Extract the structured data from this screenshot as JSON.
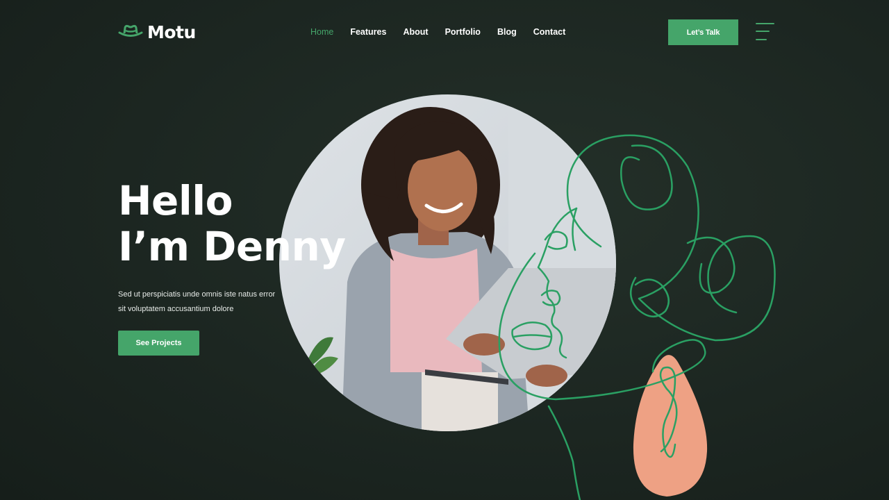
{
  "brand": {
    "name": "Motu",
    "logo_icon": "hat-icon",
    "accent_color": "#45a56a",
    "blob_color": "#eea184"
  },
  "nav": {
    "items": [
      {
        "label": "Home",
        "active": true
      },
      {
        "label": "Features",
        "active": false
      },
      {
        "label": "About",
        "active": false
      },
      {
        "label": "Portfolio",
        "active": false
      },
      {
        "label": "Blog",
        "active": false
      },
      {
        "label": "Contact",
        "active": false
      }
    ],
    "cta_label": "Let’s Talk",
    "menu_icon": "hamburger-menu-icon"
  },
  "hero": {
    "headline_line1": "Hello",
    "headline_line2": "I’m Denny",
    "intro_line1": "Sed ut perspiciatis unde omnis iste natus error",
    "intro_line2": "sit voluptatem accusantium dolore",
    "button_label": "See Projects"
  }
}
